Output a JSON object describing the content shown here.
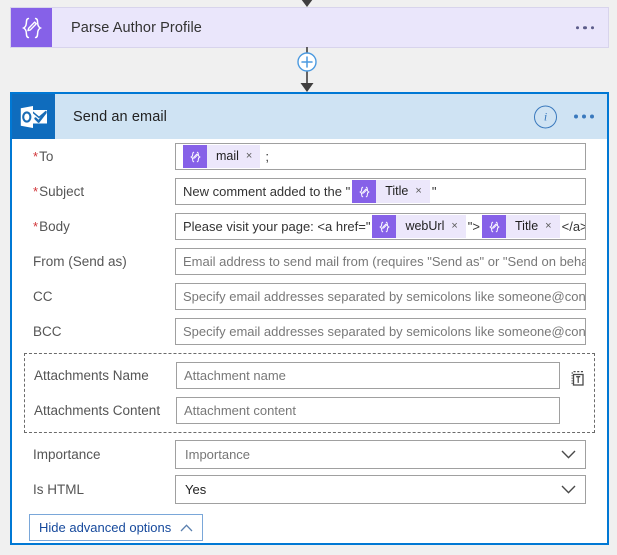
{
  "flow": {
    "previous_action": {
      "title": "Parse Author Profile",
      "icon": "braces-pencil-icon",
      "more_menu": "more-options",
      "accent_color": "#8661e8",
      "background_color": "#eae6fb"
    },
    "add_step_button": "add-step-plus"
  },
  "card": {
    "title": "Send an email",
    "icon": "outlook-icon",
    "info_label": "i",
    "accent_color": "#0078d4",
    "header_color": "#cfe3f3",
    "fields": [
      {
        "label": "To",
        "required": true,
        "name": "to",
        "parts": [
          {
            "kind": "token",
            "label": "mail",
            "remove": "×"
          },
          {
            "kind": "text",
            "value": ";"
          }
        ]
      },
      {
        "label": "Subject",
        "required": true,
        "name": "subject",
        "parts": [
          {
            "kind": "text",
            "value": "New comment added to the \""
          },
          {
            "kind": "token",
            "label": "Title",
            "remove": "×"
          },
          {
            "kind": "text",
            "value": "\""
          }
        ]
      },
      {
        "label": "Body",
        "required": true,
        "name": "body",
        "parts": [
          {
            "kind": "text",
            "value": "Please visit your page: <a href=\""
          },
          {
            "kind": "token",
            "label": "webUrl",
            "remove": "×"
          },
          {
            "kind": "text",
            "value": "\">"
          },
          {
            "kind": "token",
            "label": "Title",
            "remove": "×"
          },
          {
            "kind": "text",
            "value": "</a>"
          }
        ]
      },
      {
        "label": "From (Send as)",
        "required": false,
        "name": "from-send-as",
        "placeholder": "Email address to send mail from (requires \"Send as\" or \"Send on behalf of\" permissions)"
      },
      {
        "label": "CC",
        "required": false,
        "name": "cc",
        "placeholder": "Specify email addresses separated by semicolons like someone@contoso.com"
      },
      {
        "label": "BCC",
        "required": false,
        "name": "bcc",
        "placeholder": "Specify email addresses separated by semicolons like someone@contoso.com"
      }
    ],
    "attachments": {
      "delete_button": "delete-attachment",
      "rows": [
        {
          "label": "Attachments Name",
          "name": "attachments-name",
          "placeholder": "Attachment name"
        },
        {
          "label": "Attachments Content",
          "name": "attachments-content",
          "placeholder": "Attachment content"
        }
      ]
    },
    "dropdowns": [
      {
        "label": "Importance",
        "name": "importance",
        "value": "Importance",
        "is_placeholder": true
      },
      {
        "label": "Is HTML",
        "name": "is-html",
        "value": "Yes",
        "is_placeholder": false
      }
    ],
    "advanced_button": "Hide advanced options"
  }
}
